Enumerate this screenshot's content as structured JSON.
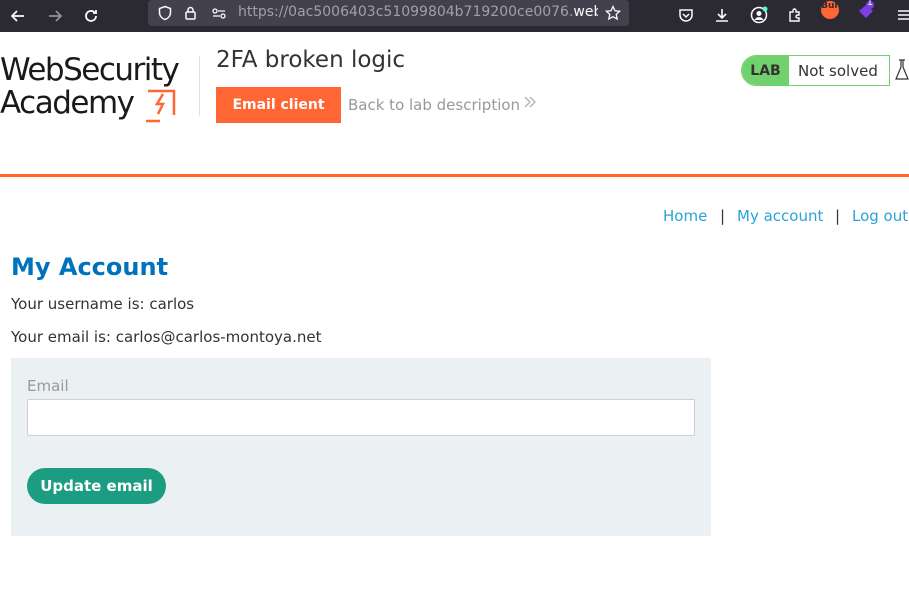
{
  "browser": {
    "url_prefix": "https://0ac5006403c51099804b719200ce0076.",
    "url_highlight": "web-sec",
    "badges": {
      "burp": "Bur",
      "count": "1"
    }
  },
  "lab": {
    "logo_line1": "WebSecurity",
    "logo_line2": "Academy",
    "title": "2FA broken logic",
    "email_client_label": "Email client",
    "back_link_label": "Back to lab description",
    "status_badge": "LAB",
    "status_text": "Not solved"
  },
  "nav": {
    "home": "Home",
    "my_account": "My account",
    "log_out": "Log out",
    "separator": "|"
  },
  "account": {
    "heading": "My Account",
    "username_line": "Your username is: carlos",
    "email_line": "Your email is: carlos@carlos-montoya.net"
  },
  "form": {
    "email_label": "Email",
    "email_value": "",
    "submit_label": "Update email"
  },
  "colors": {
    "accent_orange": "#ff6633",
    "link_blue": "#29a3d9",
    "heading_blue": "#0071bc",
    "button_green": "#1c9d81",
    "lab_green": "#70d16d"
  }
}
